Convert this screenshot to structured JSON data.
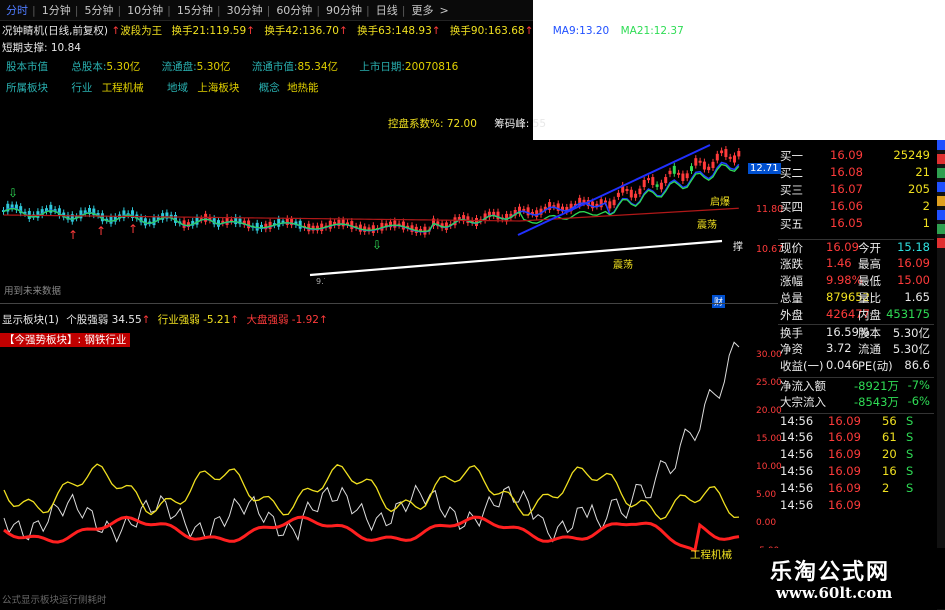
{
  "tabs": [
    {
      "label": "分时",
      "active": true
    },
    {
      "label": "1分钟"
    },
    {
      "label": "5分钟"
    },
    {
      "label": "10分钟"
    },
    {
      "label": "15分钟"
    },
    {
      "label": "30分钟"
    },
    {
      "label": "60分钟"
    },
    {
      "label": "90分钟"
    },
    {
      "label": "日线"
    },
    {
      "label": "更多"
    }
  ],
  "more_chevron": ">",
  "header": {
    "title": "况钟睛机(日线,前复权)",
    "title_arrow": "↑",
    "wave_label": "波段为王",
    "hs1": "换手21:119.59",
    "hs2": "换手42:136.70",
    "hs3": "换手63:148.93",
    "hs4": "换手90:163.68",
    "ma_a": "MA9:13.20",
    "ma21": "MA21:12.37",
    "short_support": "短期支撑: 10.84"
  },
  "info": {
    "share_cap_label": "股本市值",
    "total_cap_label": "总股本:",
    "total_cap": "5.30亿",
    "float_label": "流通盘:",
    "float_val": "5.30亿",
    "float_mkt_label": "流通市值:",
    "float_mkt": "85.34亿",
    "ipo_label": "上市日期:",
    "ipo": "20070816",
    "sector_label": "所属板块",
    "industry_label": "行业",
    "industry": "工程机械",
    "region_label": "地域",
    "region": "上海板块",
    "concept_label": "概念",
    "concept": "地热能",
    "control_label": "控盘系数%:",
    "control": "72.00",
    "chip_label": "筹码峰:",
    "chip": "55"
  },
  "chart_labels": {
    "price_tag": "12.71",
    "y1": "11.80",
    "y2": "10.67",
    "y3": "",
    "low_mark": "9.7",
    "future": "用到未来数据",
    "bounce1": "启爆",
    "bounce2": "震荡",
    "support": "撑",
    "bounce3": "震荡"
  },
  "lower": {
    "title": "显示板块(1)",
    "stock_strong_label": "个股强弱",
    "stock_strong": "34.55",
    "stock_strong_arrow": "↑",
    "industry_strong_label": "行业强弱",
    "industry_strong": "-5.21",
    "industry_strong_arrow": "↑",
    "market_strong_label": "大盘强弱",
    "market_strong": "-1.92",
    "market_strong_arrow": "↑",
    "badge": "【今强势板块】: 钢铁行业",
    "footer": "公式显示板块运行侧耗时",
    "sector_name": "工程机械",
    "y_ticks": [
      "30.00",
      "25.00",
      "20.00",
      "15.00",
      "10.00",
      "5.00",
      "0.00",
      "-5.00"
    ]
  },
  "quote": {
    "bids": [
      {
        "label": "买一",
        "price": "16.09",
        "vol": "25249"
      },
      {
        "label": "买二",
        "price": "16.08",
        "vol": "21"
      },
      {
        "label": "买三",
        "price": "16.07",
        "vol": "205"
      },
      {
        "label": "买四",
        "price": "16.06",
        "vol": "2"
      },
      {
        "label": "买五",
        "price": "16.05",
        "vol": "1"
      }
    ],
    "stats": [
      {
        "l1": "现价",
        "v1": "16.09",
        "l2": "今开",
        "v2": "15.18"
      },
      {
        "l1": "涨跌",
        "v1": "1.46",
        "l2": "最高",
        "v2": "16.09"
      },
      {
        "l1": "涨幅",
        "v1": "9.98%",
        "l2": "最低",
        "v2": "15.00"
      },
      {
        "l1": "总量",
        "v1": "879652",
        "l2": "量比",
        "v2": "1.65"
      },
      {
        "l1": "外盘",
        "v1": "426477",
        "l2": "内盘",
        "v2": "453175"
      },
      {
        "l1": "换手",
        "v1": "16.59%",
        "l2": "股本",
        "v2": "5.30亿"
      },
      {
        "l1": "净资",
        "v1": "3.72",
        "l2": "流通",
        "v2": "5.30亿"
      },
      {
        "l1": "收益(一)",
        "v1": "0.046",
        "l2": "PE(动)",
        "v2": "86.6"
      }
    ],
    "flow": [
      {
        "label": "净流入额",
        "val": "-8921万",
        "pct": "-7%"
      },
      {
        "label": "大宗流入",
        "val": "-8543万",
        "pct": "-6%"
      }
    ],
    "ticks": [
      {
        "time": "14:56",
        "price": "16.09",
        "vol": "56",
        "side": "S"
      },
      {
        "time": "14:56",
        "price": "16.09",
        "vol": "61",
        "side": "S"
      },
      {
        "time": "14:56",
        "price": "16.09",
        "vol": "20",
        "side": "S"
      },
      {
        "time": "14:56",
        "price": "16.09",
        "vol": "16",
        "side": "S"
      },
      {
        "time": "14:56",
        "price": "16.09",
        "vol": "2",
        "side": "S"
      },
      {
        "time": "14:56",
        "price": "16.09",
        "vol": "",
        "side": ""
      }
    ]
  },
  "watermark": {
    "cn": "乐淘公式网",
    "url": "www.60lt.com"
  },
  "colors": {
    "up": "#ff3b3b",
    "down": "#2fe0e0",
    "ma_blue": "#2040ff",
    "ma_green": "#2fdc55",
    "ma_red": "#b01818",
    "yellow": "#f0e020"
  }
}
